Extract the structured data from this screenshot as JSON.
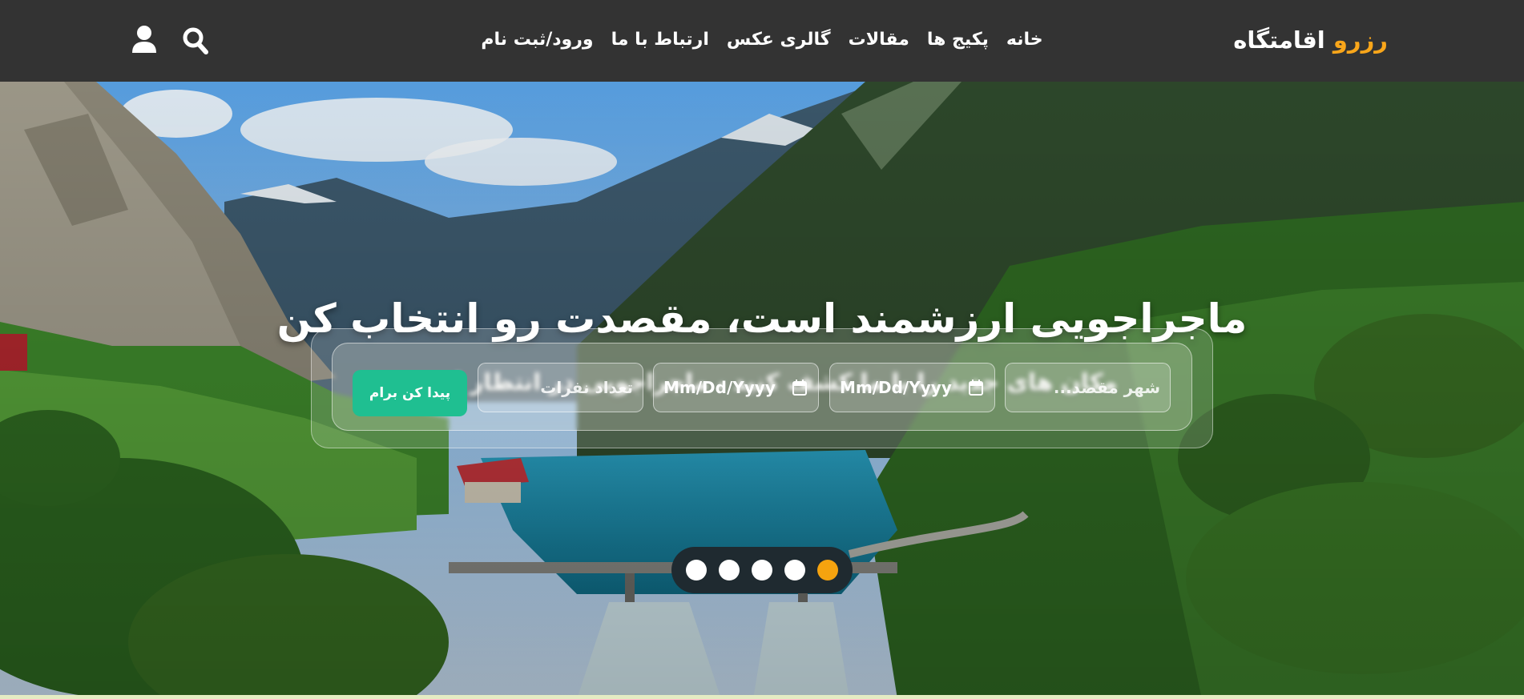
{
  "header": {
    "brand": {
      "part1": "رزرو",
      "part2": "اقامتگاه"
    },
    "menu": [
      {
        "label": "خانه"
      },
      {
        "label": "پکیج ها"
      },
      {
        "label": "مقالات"
      },
      {
        "label": "گالری عکس"
      },
      {
        "label": "ارتباط با ما"
      },
      {
        "label": "ورود/ثبت نام"
      }
    ],
    "icons": [
      "search-icon",
      "user-icon"
    ]
  },
  "hero": {
    "title": "ماجراجویی ارزشمند است، مقصدت رو انتخاب کن",
    "subtitle": "مکان های جدید را با ما کشف کنید ، ماجراجویی در انتظار است"
  },
  "search": {
    "destination_placeholder": "شهر مقصد...",
    "date_from_placeholder": "Mm/Dd/Yyyy",
    "date_to_placeholder": "Mm/Dd/Yyyy",
    "guests_placeholder": "تعداد نفرات",
    "submit_label": "پیدا کن برام"
  },
  "slider": {
    "count": 5,
    "active_index": 4
  },
  "colors": {
    "header_bg": "#333333",
    "brand_accent": "#f9a61a",
    "button": "#1fbf91",
    "active_dot": "#f5a30f"
  }
}
